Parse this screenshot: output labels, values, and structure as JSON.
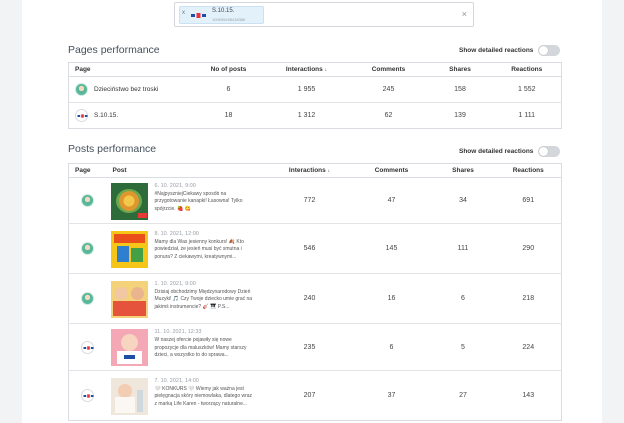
{
  "picker": {
    "chip_name": "S.10.15.",
    "chip_id": "100595498438386",
    "remove_icon": "x",
    "clear_icon": "×"
  },
  "pages_performance": {
    "title": "Pages performance",
    "toggle_label": "Show detailed reactions",
    "columns": [
      "Page",
      "No of posts",
      "Interactions",
      "Comments",
      "Shares",
      "Reactions"
    ],
    "sort_indicator": "↓",
    "rows": [
      {
        "avatar": "green",
        "name": "Dzieciństwo bez troski",
        "posts": "6",
        "interactions": "1 955",
        "comments": "245",
        "shares": "158",
        "reactions": "1 552"
      },
      {
        "avatar": "logo",
        "name": "S.10.15.",
        "posts": "18",
        "interactions": "1 312",
        "comments": "62",
        "shares": "139",
        "reactions": "1 111"
      }
    ]
  },
  "posts_performance": {
    "title": "Posts performance",
    "toggle_label": "Show detailed reactions",
    "columns": [
      "Page",
      "Post",
      "Interactions",
      "Comments",
      "Shares",
      "Reactions"
    ],
    "sort_indicator": "↓",
    "rows": [
      {
        "avatar": "green",
        "thumb": "food",
        "date": "6. 10. 2021, 9:00",
        "text": "#NajpyszniejCiekawy sposób na przygotowanie kanapki! Łasowna! Tylko spójrzcie. 🍓 😋",
        "interactions": "772",
        "comments": "47",
        "shares": "34",
        "reactions": "691"
      },
      {
        "avatar": "green",
        "thumb": "toys",
        "date": "8. 10. 2021, 12:00",
        "text": "Mamy dla Was jesienny konkurs! 🍂 Kto powiedział, że jesień musi być smutna i ponura? Z ciekawymi, kreatywnymi...",
        "interactions": "546",
        "comments": "145",
        "shares": "111",
        "reactions": "290"
      },
      {
        "avatar": "green",
        "thumb": "kids",
        "date": "1. 10. 2021, 9:00",
        "text": "Dzisiaj obchodzimy Międzynarodowy Dzień Muzyki! 🎵 Czy Twoje dziecko umie grać na jakimś instrumencie? 🎸 🎹 P.S...",
        "interactions": "240",
        "comments": "16",
        "shares": "6",
        "reactions": "218"
      },
      {
        "avatar": "logo",
        "thumb": "pink",
        "date": "11. 10. 2021, 12:33",
        "text": "W naszej ofercie pojawiły się nowe propozycje dla maluszków! Mamy starszy dzieci, a wszystko to do sprawa...",
        "interactions": "235",
        "comments": "6",
        "shares": "5",
        "reactions": "224"
      },
      {
        "avatar": "logo",
        "thumb": "baby",
        "date": "7. 10. 2021, 14:00",
        "text": "🤍 KONKURS 🤍 Wiemy jak ważna jest pielęgnacja skóry niemowlaka, dlatego wraz z marką Life Karen - tworzący naturalne...",
        "interactions": "207",
        "comments": "37",
        "shares": "27",
        "reactions": "143"
      }
    ]
  },
  "colors": {
    "accent_avatar": "#59b89a",
    "chip_bg": "#e3f1fb",
    "toggle_off": "#d3d6da",
    "logo_blue": "#1f4fa3"
  }
}
